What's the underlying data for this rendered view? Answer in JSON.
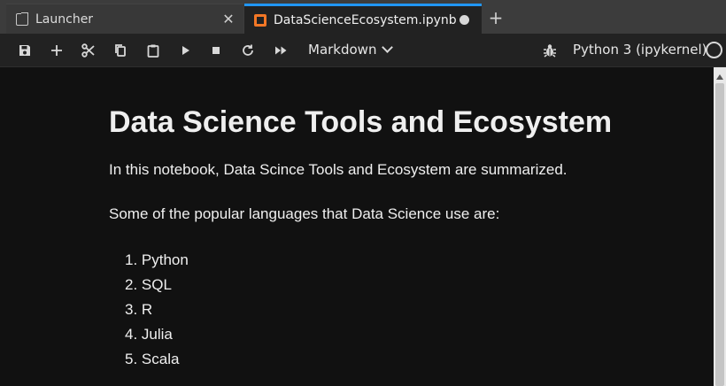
{
  "tabs": [
    {
      "label": "Launcher",
      "icon": "launcher-icon",
      "close": "✕"
    },
    {
      "label": "DataScienceEcosystem.ipynb",
      "icon": "notebook-icon",
      "unsaved": true
    }
  ],
  "toolbar": {
    "buttons": [
      "save-icon",
      "add-icon",
      "cut-icon",
      "copy-icon",
      "paste-icon",
      "run-icon",
      "stop-icon",
      "restart-icon",
      "fast-forward-icon"
    ],
    "cell_type": "Markdown",
    "kernel_name": "Python 3 (ipykernel)"
  },
  "notebook": {
    "title": "Data Science Tools and Ecosystem",
    "intro": "In this notebook, Data Scince Tools and Ecosystem are summarized.",
    "languages_heading": "Some of the popular languages that Data Science use are:",
    "languages": [
      "1. Python",
      "2. SQL",
      "3. R",
      "4. Julia",
      "5. Scala"
    ]
  },
  "colors": {
    "accent": "#2196f3",
    "notebook_icon": "#f37726",
    "background": "#111111"
  }
}
